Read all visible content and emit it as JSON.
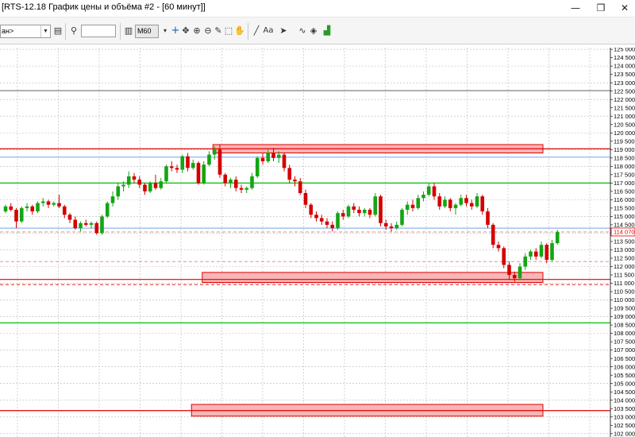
{
  "window": {
    "title": "[RTS-12.18 График цены и объёма #2 - [60 минут]]",
    "minimize_glyph": "—",
    "maximize_glyph": "❐",
    "close_glyph": "✕"
  },
  "toolbar": {
    "instrument_value": "ан>",
    "timeframe_value": "M60",
    "font_label": "Aa",
    "find_value": ""
  },
  "icons": [
    "instrument-dropdown-icon",
    "instrument-info-icon",
    "search-icon",
    "chart-type-icon",
    "crosshair-icon",
    "move-icon",
    "zoom-in-icon",
    "zoom-out-icon",
    "draw-pencil-icon",
    "select-cursor-icon",
    "hand-icon",
    "trendline-icon",
    "text-icon",
    "marker-icon",
    "pattern-icon",
    "indicator-icon",
    "trade-icon"
  ],
  "colors": {
    "candle_up": "#14a514",
    "candle_down": "#d40000",
    "resistance_line": "#e00000",
    "zone_fill": "#f7b6b6",
    "support_line_green": "#00c000",
    "grey_level": "#707070",
    "blue_level": "#8fb4ee",
    "grid": "#b8b8b8"
  },
  "chart_data": {
    "type": "candlestick",
    "instrument": "RTS-12.18",
    "timeframe": "60 минут",
    "ylim": [
      101800,
      125100
    ],
    "y_ticks": [
      102000,
      102500,
      103000,
      103500,
      104000,
      104500,
      105000,
      105500,
      106000,
      106500,
      107000,
      107500,
      108000,
      108500,
      109000,
      109500,
      110000,
      110500,
      111000,
      111500,
      112000,
      112500,
      113000,
      113500,
      114000,
      114500,
      115000,
      115500,
      116000,
      116500,
      117000,
      117500,
      118000,
      118500,
      119000,
      119500,
      120000,
      120500,
      121000,
      121500,
      122000,
      122500,
      123000,
      123500,
      124000,
      124500,
      125000
    ],
    "last_price_label": "114 070",
    "last_price": 114070,
    "candles": [
      [
        115300,
        115700,
        115200,
        115600
      ],
      [
        115600,
        115800,
        115300,
        115400
      ],
      [
        115400,
        115500,
        114300,
        114700
      ],
      [
        114700,
        115600,
        114600,
        115500
      ],
      [
        115500,
        115800,
        115300,
        115600
      ],
      [
        115600,
        115700,
        115100,
        115300
      ],
      [
        115300,
        115900,
        115200,
        115800
      ],
      [
        115800,
        116100,
        115600,
        115900
      ],
      [
        115900,
        116000,
        115500,
        115700
      ],
      [
        115700,
        115900,
        115600,
        115800
      ],
      [
        115800,
        116300,
        115500,
        115600
      ],
      [
        115600,
        115700,
        114900,
        115100
      ],
      [
        115100,
        115200,
        114600,
        114800
      ],
      [
        114800,
        115000,
        114200,
        114300
      ],
      [
        114300,
        114700,
        114100,
        114600
      ],
      [
        114600,
        114800,
        114400,
        114500
      ],
      [
        114500,
        114700,
        114300,
        114600
      ],
      [
        114600,
        114700,
        113900,
        114000
      ],
      [
        114000,
        115100,
        113900,
        115000
      ],
      [
        115000,
        115900,
        114900,
        115800
      ],
      [
        115800,
        116500,
        115600,
        116200
      ],
      [
        116200,
        117000,
        116000,
        116800
      ],
      [
        116800,
        117100,
        116500,
        116900
      ],
      [
        116900,
        117700,
        116700,
        117400
      ],
      [
        117400,
        117600,
        117000,
        117200
      ],
      [
        117200,
        117400,
        116700,
        116900
      ],
      [
        116900,
        117000,
        116300,
        116500
      ],
      [
        116500,
        117100,
        116400,
        117000
      ],
      [
        117000,
        117500,
        116600,
        116700
      ],
      [
        116700,
        117300,
        116600,
        117100
      ],
      [
        117100,
        118100,
        117000,
        118000
      ],
      [
        118000,
        118300,
        117700,
        117900
      ],
      [
        117900,
        118100,
        117600,
        117800
      ],
      [
        117800,
        118700,
        117600,
        118600
      ],
      [
        118600,
        118800,
        117700,
        117900
      ],
      [
        117900,
        118400,
        117800,
        118200
      ],
      [
        118200,
        118300,
        116900,
        117000
      ],
      [
        117000,
        118300,
        116900,
        118100
      ],
      [
        118100,
        118900,
        118000,
        118700
      ],
      [
        118700,
        119200,
        118400,
        119000
      ],
      [
        119000,
        119300,
        117300,
        117500
      ],
      [
        117500,
        117600,
        116800,
        117000
      ],
      [
        117000,
        117300,
        116700,
        117200
      ],
      [
        117200,
        117400,
        116500,
        116700
      ],
      [
        116700,
        116900,
        116400,
        116600
      ],
      [
        116600,
        116800,
        116400,
        116700
      ],
      [
        116700,
        117600,
        116600,
        117400
      ],
      [
        117400,
        118600,
        117300,
        118500
      ],
      [
        118500,
        118800,
        118100,
        118300
      ],
      [
        118300,
        119000,
        118200,
        118800
      ],
      [
        118800,
        119100,
        118300,
        118500
      ],
      [
        118500,
        118900,
        118200,
        118700
      ],
      [
        118700,
        118800,
        117700,
        117900
      ],
      [
        117900,
        118100,
        117000,
        117200
      ],
      [
        117200,
        117400,
        116800,
        117100
      ],
      [
        117100,
        117300,
        116300,
        116400
      ],
      [
        116400,
        116600,
        115500,
        115700
      ],
      [
        115700,
        115800,
        114900,
        115100
      ],
      [
        115100,
        115300,
        114700,
        114900
      ],
      [
        114900,
        115100,
        114500,
        114700
      ],
      [
        114700,
        114900,
        114300,
        114500
      ],
      [
        114500,
        114700,
        114100,
        114300
      ],
      [
        114300,
        115300,
        114200,
        115200
      ],
      [
        115200,
        115400,
        114800,
        115000
      ],
      [
        115000,
        115700,
        114900,
        115600
      ],
      [
        115600,
        115800,
        115200,
        115400
      ],
      [
        115400,
        115600,
        115000,
        115200
      ],
      [
        115200,
        115500,
        115000,
        115400
      ],
      [
        115400,
        115500,
        114900,
        115100
      ],
      [
        115100,
        116400,
        115000,
        116200
      ],
      [
        116200,
        116300,
        114400,
        114600
      ],
      [
        114600,
        114800,
        114200,
        114400
      ],
      [
        114400,
        114600,
        114100,
        114300
      ],
      [
        114300,
        114700,
        114200,
        114500
      ],
      [
        114500,
        115500,
        114400,
        115400
      ],
      [
        115400,
        115900,
        115100,
        115700
      ],
      [
        115700,
        116000,
        115300,
        115500
      ],
      [
        115500,
        116300,
        115400,
        116100
      ],
      [
        116100,
        116500,
        115900,
        116300
      ],
      [
        116300,
        117000,
        116200,
        116800
      ],
      [
        116800,
        117000,
        116000,
        116200
      ],
      [
        116200,
        116400,
        115400,
        115600
      ],
      [
        115600,
        116200,
        115500,
        116000
      ],
      [
        116000,
        116100,
        115300,
        115500
      ],
      [
        115500,
        115800,
        115100,
        115700
      ],
      [
        115700,
        116300,
        115600,
        116100
      ],
      [
        116100,
        116300,
        115600,
        115800
      ],
      [
        115800,
        116000,
        115400,
        115600
      ],
      [
        115600,
        116400,
        115500,
        116200
      ],
      [
        116200,
        116300,
        115100,
        115300
      ],
      [
        115300,
        115500,
        114300,
        114500
      ],
      [
        114500,
        114600,
        113100,
        113300
      ],
      [
        113300,
        113500,
        112900,
        113100
      ],
      [
        113100,
        113200,
        111900,
        112100
      ],
      [
        112100,
        112300,
        111200,
        111500
      ],
      [
        111500,
        111700,
        111100,
        111300
      ],
      [
        111300,
        112200,
        111200,
        112000
      ],
      [
        112000,
        112800,
        111800,
        112600
      ],
      [
        112600,
        113000,
        112400,
        112900
      ],
      [
        112900,
        113100,
        112400,
        112600
      ],
      [
        112600,
        113500,
        112500,
        113300
      ],
      [
        113300,
        113400,
        112200,
        112400
      ],
      [
        112400,
        113600,
        112300,
        113400
      ],
      [
        113400,
        114200,
        113300,
        114070
      ]
    ],
    "horizontal_levels": [
      {
        "price": 122530,
        "color": "#707070",
        "style": "solid"
      },
      {
        "price": 119050,
        "color": "#e00000",
        "style": "solid"
      },
      {
        "price": 118550,
        "color": "#8fb4ee",
        "style": "solid"
      },
      {
        "price": 117000,
        "color": "#00c000",
        "style": "solid"
      },
      {
        "price": 114300,
        "color": "#8fb4ee",
        "style": "solid"
      },
      {
        "price": 114070,
        "color": "#e08080",
        "style": "dashed"
      },
      {
        "price": 112300,
        "color": "#e08080",
        "style": "dashed"
      },
      {
        "price": 111230,
        "color": "#e00000",
        "style": "solid"
      },
      {
        "price": 110920,
        "color": "#e00000",
        "style": "dashed"
      },
      {
        "price": 108630,
        "color": "#00c000",
        "style": "solid"
      },
      {
        "price": 103380,
        "color": "#e00000",
        "style": "solid"
      }
    ],
    "zones": [
      {
        "from_candle": 39,
        "to_candle": 100,
        "low": 118800,
        "high": 119300
      },
      {
        "from_candle": 37,
        "to_candle": 100,
        "low": 111050,
        "high": 111650
      },
      {
        "from_candle": 35,
        "to_candle": 100,
        "low": 103050,
        "high": 103750
      }
    ]
  }
}
